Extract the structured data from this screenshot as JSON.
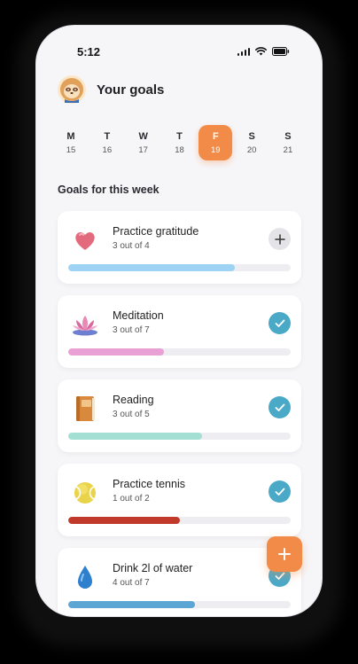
{
  "status_bar": {
    "time": "5:12"
  },
  "header": {
    "title": "Your goals",
    "avatar_icon": "sloth-avatar-icon"
  },
  "week": [
    {
      "day": "M",
      "date": "15",
      "active": false
    },
    {
      "day": "T",
      "date": "16",
      "active": false
    },
    {
      "day": "W",
      "date": "17",
      "active": false
    },
    {
      "day": "T",
      "date": "18",
      "active": false
    },
    {
      "day": "F",
      "date": "19",
      "active": true
    },
    {
      "day": "S",
      "date": "20",
      "active": false
    },
    {
      "day": "S",
      "date": "21",
      "active": false
    }
  ],
  "section_title": "Goals for this week",
  "goals": [
    {
      "name": "Practice gratitude",
      "progress_text": "3 out of 4",
      "progress": 0.75,
      "color": "#9fd3f3",
      "icon": "heart-icon",
      "action": "add"
    },
    {
      "name": "Meditation",
      "progress_text": "3 out of 7",
      "progress": 0.43,
      "color": "#e9a0d4",
      "icon": "lotus-icon",
      "action": "done"
    },
    {
      "name": "Reading",
      "progress_text": "3 out of 5",
      "progress": 0.6,
      "color": "#a4dfd3",
      "icon": "book-icon",
      "action": "done"
    },
    {
      "name": "Practice tennis",
      "progress_text": "1 out of 2",
      "progress": 0.5,
      "color": "#c0392b",
      "icon": "tennis-ball-icon",
      "action": "done"
    },
    {
      "name": "Drink 2l of water",
      "progress_text": "4 out of 7",
      "progress": 0.57,
      "color": "#5ca6d6",
      "icon": "water-drop-icon",
      "action": "done"
    }
  ],
  "colors": {
    "accent": "#f28b47",
    "check": "#4ba9c8"
  },
  "fab": {
    "icon": "plus-icon"
  }
}
